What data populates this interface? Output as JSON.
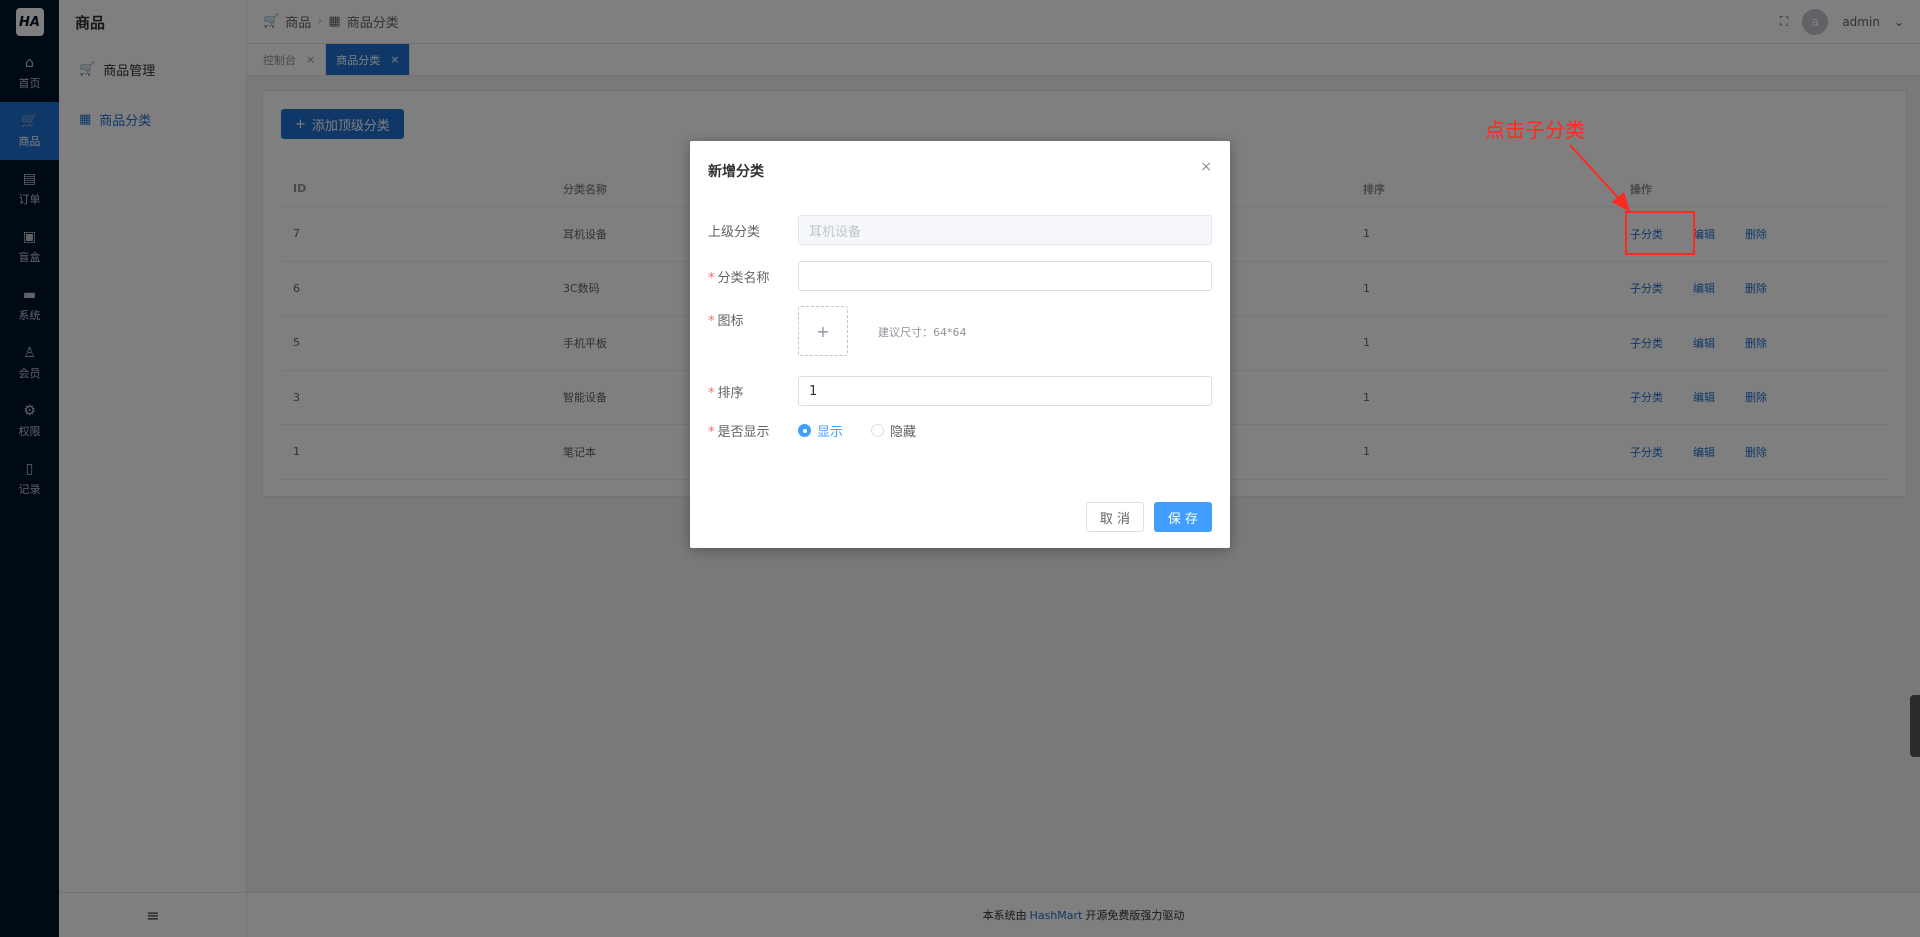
{
  "logo": {
    "text": "HA"
  },
  "nav": [
    {
      "label": "首页",
      "icon": "home-icon",
      "glyph": "⌂"
    },
    {
      "label": "商品",
      "icon": "cart-icon",
      "glyph": "🛒"
    },
    {
      "label": "订单",
      "icon": "document-icon",
      "glyph": "▤"
    },
    {
      "label": "盲盒",
      "icon": "box-icon",
      "glyph": "▣"
    },
    {
      "label": "系统",
      "icon": "monitor-icon",
      "glyph": "▬"
    },
    {
      "label": "会员",
      "icon": "user-icon",
      "glyph": "♙"
    },
    {
      "label": "权限",
      "icon": "gear-icon",
      "glyph": "⚙"
    },
    {
      "label": "记录",
      "icon": "notebook-icon",
      "glyph": "▯"
    }
  ],
  "sub": {
    "title": "商品",
    "menu": [
      {
        "label": "商品管理",
        "icon": "cart-icon",
        "glyph": "🛒"
      },
      {
        "label": "商品分类",
        "icon": "bag-icon",
        "glyph": "▦"
      }
    ],
    "collapse_glyph": "≡"
  },
  "breadcrumb": {
    "first": "商品",
    "second": "商品分类"
  },
  "header": {
    "user": "admin",
    "avatar": "a"
  },
  "tabs": [
    {
      "label": "控制台",
      "close": "×"
    },
    {
      "label": "商品分类",
      "close": "×"
    }
  ],
  "toolbar": {
    "add_label": "添加顶级分类"
  },
  "table": {
    "headers": {
      "id": "ID",
      "name": "分类名称",
      "order": "排序",
      "ops": "操作"
    },
    "ops": {
      "child": "子分类",
      "edit": "编辑",
      "del": "删除"
    },
    "rows": [
      {
        "id": "7",
        "name": "耳机设备",
        "order": "1"
      },
      {
        "id": "6",
        "name": "3C数码",
        "order": "1"
      },
      {
        "id": "5",
        "name": "手机平板",
        "order": "1"
      },
      {
        "id": "3",
        "name": "智能设备",
        "order": "1"
      },
      {
        "id": "1",
        "name": "笔记本",
        "order": "1"
      }
    ]
  },
  "footer": {
    "before": "本系统由",
    "brand": "HashMart",
    "after": "开源免费版强力驱动"
  },
  "annotation": {
    "text": "点击子分类",
    "color": "#ff2a1f"
  },
  "modal": {
    "title": "新增分类",
    "close": "×",
    "parent_label": "上级分类",
    "parent_value": "耳机设备",
    "name_label": "分类名称",
    "name_value": "",
    "icon_label": "图标",
    "icon_plus": "+",
    "icon_hint": "建议尺寸：64*64",
    "order_label": "排序",
    "order_value": "1",
    "show_label": "是否显示",
    "show_options": [
      "显示",
      "隐藏"
    ],
    "cancel": "取 消",
    "save": "保 存"
  },
  "colors": {
    "primary": "#1f6fd1",
    "accent": "#409eff",
    "sidebar": "#001529"
  }
}
